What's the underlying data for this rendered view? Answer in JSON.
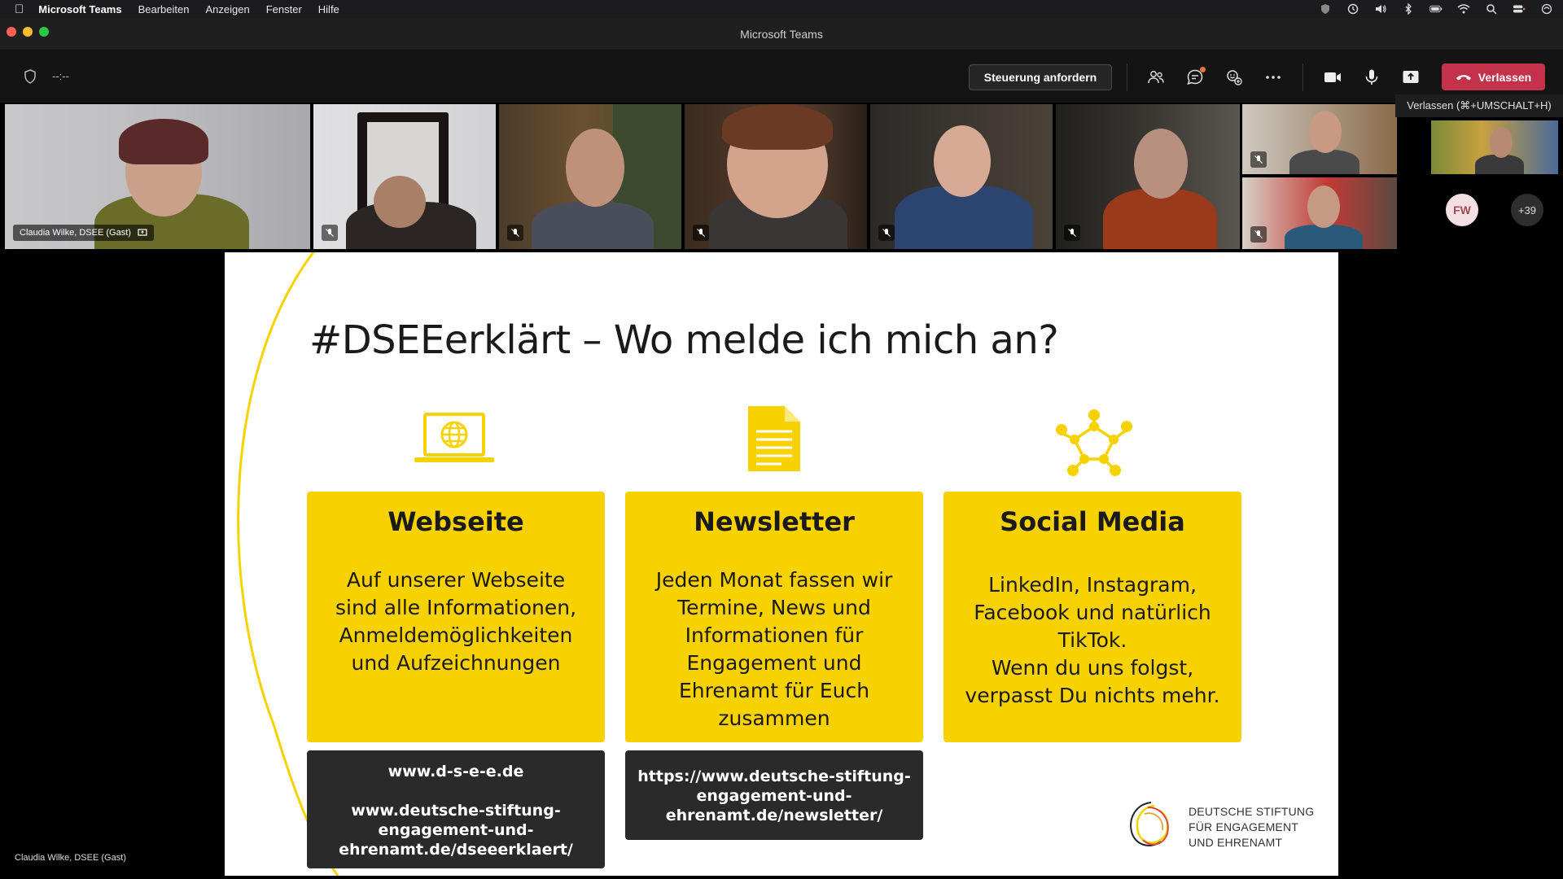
{
  "menubar": {
    "app_name": "Microsoft Teams",
    "items": [
      "Bearbeiten",
      "Anzeigen",
      "Fenster",
      "Hilfe"
    ],
    "status_icons": [
      "shield-check-icon",
      "clock-icon",
      "volume-icon",
      "bluetooth-icon",
      "battery-icon",
      "wifi-icon",
      "spotlight-search-icon",
      "control-center-icon",
      "siri-icon"
    ]
  },
  "window": {
    "title": "Microsoft Teams"
  },
  "toolbar": {
    "timer": "--:--",
    "request_control_label": "Steuerung anfordern",
    "leave_label": "Verlassen",
    "leave_tooltip": "Verlassen (⌘+UMSCHALT+H)",
    "icons": [
      "people-icon",
      "chat-icon",
      "reactions-icon",
      "more-options-icon",
      "camera-icon",
      "microphone-icon",
      "share-screen-icon"
    ]
  },
  "participants": {
    "first_name_tag": "Claudia Wilke, DSEE (Gast)",
    "avatar_initials": "FW",
    "overflow_count": "+39"
  },
  "slide": {
    "title": "#DSEEerklärt – Wo melde ich mich an?",
    "columns": [
      {
        "icon": "laptop-globe-icon",
        "title": "Webseite",
        "lines": [
          "Auf unserer Webseite",
          "sind alle Informationen,",
          "Anmeldemöglichkeiten",
          "und Aufzeichnungen"
        ],
        "links": [
          "www.d-s-e-e.de",
          "",
          "www.deutsche-stiftung-",
          "engagement-und-",
          "ehrenamt.de/dseeerklaert/"
        ]
      },
      {
        "icon": "document-icon",
        "title": "Newsletter",
        "lines": [
          "Jeden Monat fassen wir",
          "Termine, News und",
          "Informationen für",
          "Engagement und",
          "Ehrenamt für Euch",
          "zusammen"
        ],
        "links": [
          "https://www.deutsche-stiftung-",
          "engagement-und-",
          "ehrenamt.de/newsletter/"
        ]
      },
      {
        "icon": "network-people-icon",
        "title": "Social Media",
        "lines": [
          "LinkedIn, Instagram,",
          "Facebook und natürlich",
          "TikTok.",
          "Wenn du uns folgst,",
          "verpasst Du nichts mehr."
        ]
      }
    ],
    "logo_lines": [
      "DEUTSCHE STIFTUNG",
      "FÜR ENGAGEMENT",
      "UND EHRENAMT"
    ],
    "accent_color": "#f8d200"
  },
  "presenter_label": "Claudia Wilke, DSEE (Gast)"
}
